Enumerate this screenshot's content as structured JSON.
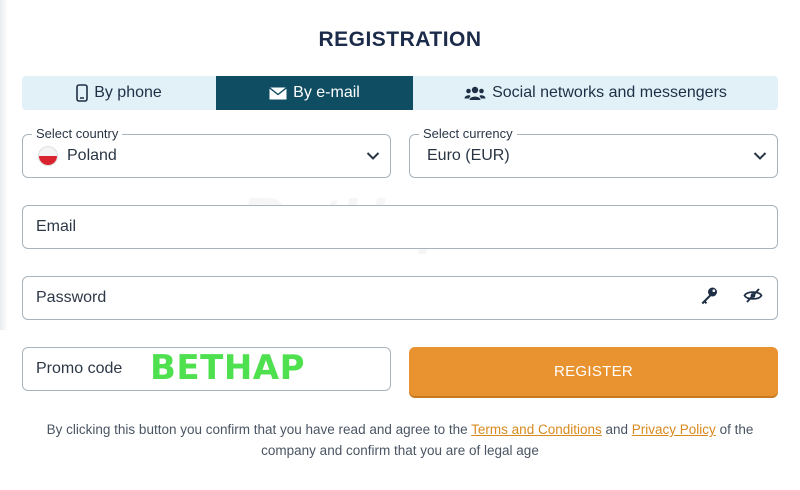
{
  "page": {
    "title": "REGISTRATION"
  },
  "tabs": [
    {
      "label": "By phone",
      "icon": "phone-icon",
      "active": false
    },
    {
      "label": "By e-mail",
      "icon": "envelope-icon",
      "active": true
    },
    {
      "label": "Social networks and messengers",
      "icon": "users-icon",
      "active": false
    }
  ],
  "country": {
    "legend": "Select country",
    "value": "Poland",
    "flag": "poland-flag-icon"
  },
  "currency": {
    "legend": "Select currency",
    "value": "Euro (EUR)"
  },
  "email": {
    "placeholder": "Email"
  },
  "password": {
    "placeholder": "Password"
  },
  "promo": {
    "placeholder": "Promo code",
    "value": "BETHAP"
  },
  "register": {
    "label": "REGISTER"
  },
  "disclaimer": {
    "part1": "By clicking this button you confirm that you have read and agree to the ",
    "terms": "Terms and Conditions",
    "part2": " and ",
    "privacy": "Privacy Policy",
    "part3": " of the company and confirm that you are of legal age"
  },
  "colors": {
    "active_tab": "#0f4d63",
    "tabs_bg": "#e2f1f8",
    "accent": "#e8932f",
    "link": "#d98a1e",
    "promo_code": "#4fe04f"
  },
  "watermark": "BetHap"
}
